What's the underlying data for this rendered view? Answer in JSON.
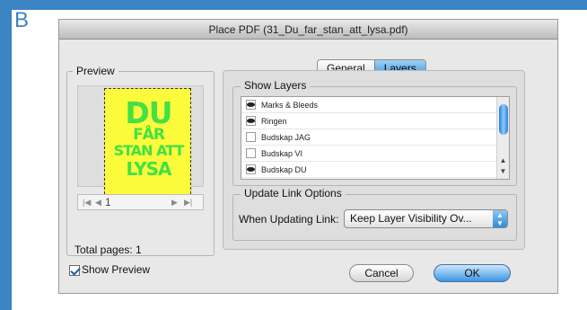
{
  "corner_label": "B",
  "dialog": {
    "title": "Place PDF (31_Du_far_stan_att_lysa.pdf)"
  },
  "preview": {
    "legend": "Preview",
    "poster": {
      "line1": "DU",
      "line2": "FÅR",
      "line3": "STAN ATT",
      "line4": "LYSA"
    },
    "page_number": "1",
    "total_pages_label": "Total pages: 1"
  },
  "tabs": [
    {
      "label": "General",
      "active": false
    },
    {
      "label": "Layers",
      "active": true
    }
  ],
  "show_layers": {
    "legend": "Show Layers",
    "items": [
      {
        "name": "Marks & Bleeds",
        "visible": true
      },
      {
        "name": "Ringen",
        "visible": true
      },
      {
        "name": "Budskap JAG",
        "visible": false
      },
      {
        "name": "Budskap VI",
        "visible": false
      },
      {
        "name": "Budskap DU",
        "visible": true
      }
    ]
  },
  "update_link": {
    "legend": "Update Link Options",
    "label": "When Updating Link:",
    "value": "Keep Layer Visibility Ov..."
  },
  "show_preview": {
    "label": "Show Preview",
    "checked": true
  },
  "buttons": {
    "cancel": "Cancel",
    "ok": "OK"
  },
  "colors": {
    "accent": "#3c84c4",
    "poster_bg": "#fbfb3c",
    "poster_text": "#44e044"
  }
}
